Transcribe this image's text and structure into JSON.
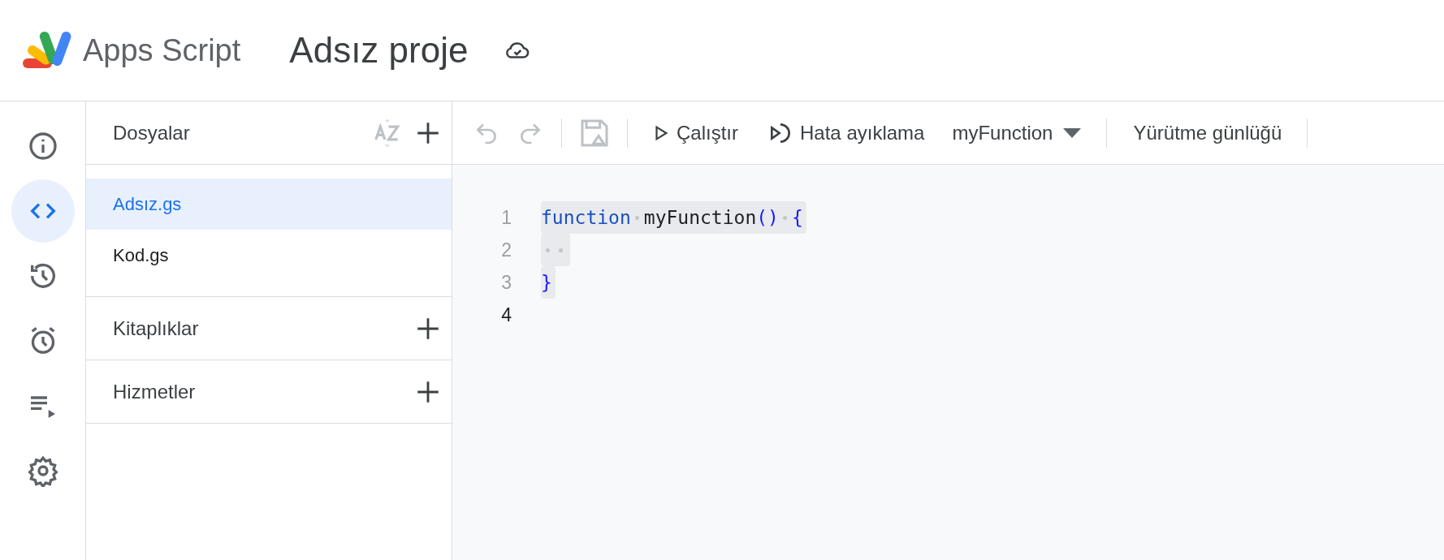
{
  "header": {
    "product": "Apps Script",
    "project_title": "Adsız proje"
  },
  "rail": [
    {
      "kind": "info",
      "selected": false
    },
    {
      "kind": "code",
      "selected": true
    },
    {
      "kind": "history",
      "selected": false
    },
    {
      "kind": "alarm",
      "selected": false
    },
    {
      "kind": "executions",
      "selected": false
    },
    {
      "kind": "settings",
      "selected": false
    }
  ],
  "files": {
    "title": "Dosyalar",
    "items": [
      {
        "label": "Adsız.gs",
        "selected": true
      },
      {
        "label": "Kod.gs",
        "selected": false
      }
    ]
  },
  "sections": [
    {
      "title": "Kitaplıklar"
    },
    {
      "title": "Hizmetler"
    }
  ],
  "toolbar": {
    "run": "Çalıştır",
    "debug": "Hata ayıklama",
    "function": "myFunction",
    "log": "Yürütme günlüğü"
  },
  "editor": {
    "lines": [
      {
        "number": "1",
        "active": false,
        "selected": true,
        "tokens": [
          {
            "kind": "keyword",
            "text": "function"
          },
          {
            "kind": "space"
          },
          {
            "kind": "name",
            "text": "myFunction"
          },
          {
            "kind": "punct",
            "text": "()"
          },
          {
            "kind": "space"
          },
          {
            "kind": "punct",
            "text": "{"
          }
        ]
      },
      {
        "number": "2",
        "active": false,
        "selected": true,
        "tokens": [
          {
            "kind": "space"
          },
          {
            "kind": "space"
          }
        ]
      },
      {
        "number": "3",
        "active": false,
        "selected": true,
        "tokens": [
          {
            "kind": "punct",
            "text": "}"
          }
        ]
      },
      {
        "number": "4",
        "active": true,
        "selected": false
      }
    ]
  }
}
